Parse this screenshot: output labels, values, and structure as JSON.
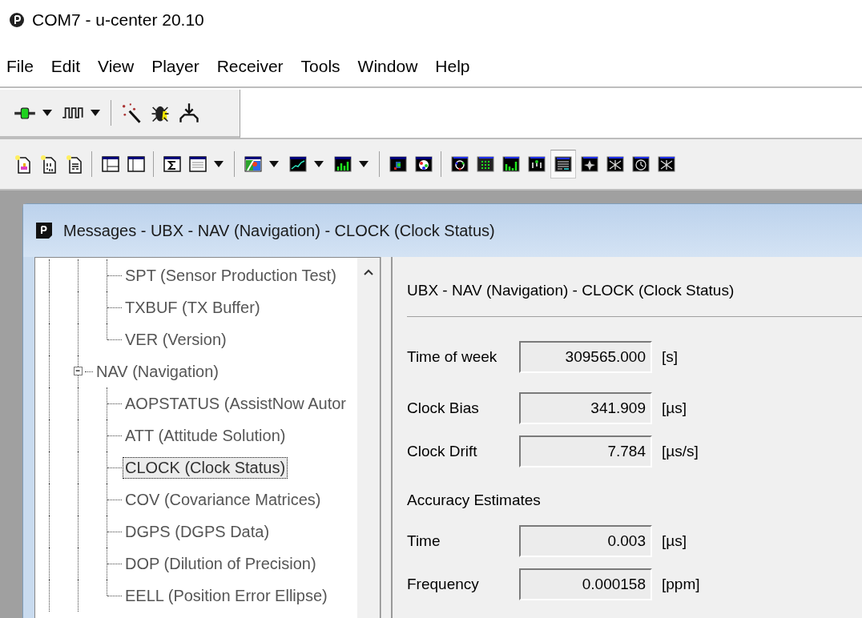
{
  "window": {
    "title": "COM7 - u-center 20.10"
  },
  "menu": [
    "File",
    "Edit",
    "View",
    "Player",
    "Receiver",
    "Tools",
    "Window",
    "Help"
  ],
  "toolbar_1": [
    {
      "kind": "connection",
      "selected": false
    },
    {
      "kind": "dropdown"
    },
    {
      "kind": "pulse",
      "selected": false
    },
    {
      "kind": "dropdown"
    },
    {
      "kind": "separator"
    },
    {
      "kind": "wand",
      "selected": false
    },
    {
      "kind": "bug",
      "selected": false
    },
    {
      "kind": "antenna",
      "selected": false
    }
  ],
  "toolbar_2": [
    {
      "kind": "doc-new",
      "selected": false
    },
    {
      "kind": "doc-binary",
      "selected": false
    },
    {
      "kind": "doc-text",
      "selected": false
    },
    {
      "kind": "separator"
    },
    {
      "kind": "window-split",
      "selected": false
    },
    {
      "kind": "window-pane",
      "selected": false
    },
    {
      "kind": "separator"
    },
    {
      "kind": "sigma",
      "selected": false
    },
    {
      "kind": "list-window",
      "selected": false
    },
    {
      "kind": "dropdown"
    },
    {
      "kind": "separator"
    },
    {
      "kind": "color-map",
      "selected": false
    },
    {
      "kind": "dropdown"
    },
    {
      "kind": "line-chart",
      "selected": false
    },
    {
      "kind": "dropdown"
    },
    {
      "kind": "bar-chart",
      "selected": false
    },
    {
      "kind": "dropdown"
    },
    {
      "kind": "separator"
    },
    {
      "kind": "map",
      "selected": false
    },
    {
      "kind": "sky-view",
      "selected": false
    },
    {
      "kind": "separator"
    },
    {
      "kind": "ring-panel",
      "selected": false
    },
    {
      "kind": "grid-panel",
      "selected": false
    },
    {
      "kind": "bars-panel",
      "selected": false
    },
    {
      "kind": "dots-panel",
      "selected": false
    },
    {
      "kind": "table-panel",
      "selected": true
    },
    {
      "kind": "star-panel",
      "selected": false
    },
    {
      "kind": "burst-panel",
      "selected": false
    },
    {
      "kind": "clock-panel",
      "selected": false
    },
    {
      "kind": "burst-panel",
      "selected": false
    }
  ],
  "messages_window": {
    "title": "Messages - UBX - NAV (Navigation) - CLOCK (Clock Status)",
    "tree": [
      {
        "kind": "continued",
        "children": [
          {
            "label": "SPT (Sensor Production Test)",
            "selected": false
          },
          {
            "label": "TXBUF (TX Buffer)",
            "selected": false
          },
          {
            "label": "VER (Version)",
            "selected": false
          }
        ]
      },
      {
        "kind": "node",
        "label": "NAV (Navigation)",
        "selected": false,
        "expanded": true,
        "children": [
          {
            "label": "AOPSTATUS (AssistNow Autor",
            "selected": false
          },
          {
            "label": "ATT (Attitude Solution)",
            "selected": false
          },
          {
            "label": "CLOCK (Clock Status)",
            "selected": true
          },
          {
            "label": "COV (Covariance Matrices)",
            "selected": false
          },
          {
            "label": "DGPS (DGPS Data)",
            "selected": false
          },
          {
            "label": "DOP (Dilution of Precision)",
            "selected": false
          },
          {
            "label": "EELL (Position Error Ellipse)",
            "selected": false
          }
        ]
      }
    ],
    "panel": {
      "heading": "UBX - NAV (Navigation) - CLOCK (Clock Status)",
      "groups": [
        {
          "rows": [
            {
              "label": "Time of week",
              "value": "309565.000",
              "unit": "[s]"
            }
          ]
        },
        {
          "rows": [
            {
              "label": "Clock Bias",
              "value": "341.909",
              "unit": "[µs]"
            },
            {
              "label": "Clock Drift",
              "value": "7.784",
              "unit": "[µs/s]"
            }
          ]
        },
        {
          "title": "Accuracy Estimates",
          "rows": [
            {
              "label": "Time",
              "value": "0.003",
              "unit": "[µs]"
            },
            {
              "label": "Frequency",
              "value": "0.000158",
              "unit": "[ppm]"
            }
          ]
        }
      ]
    }
  }
}
